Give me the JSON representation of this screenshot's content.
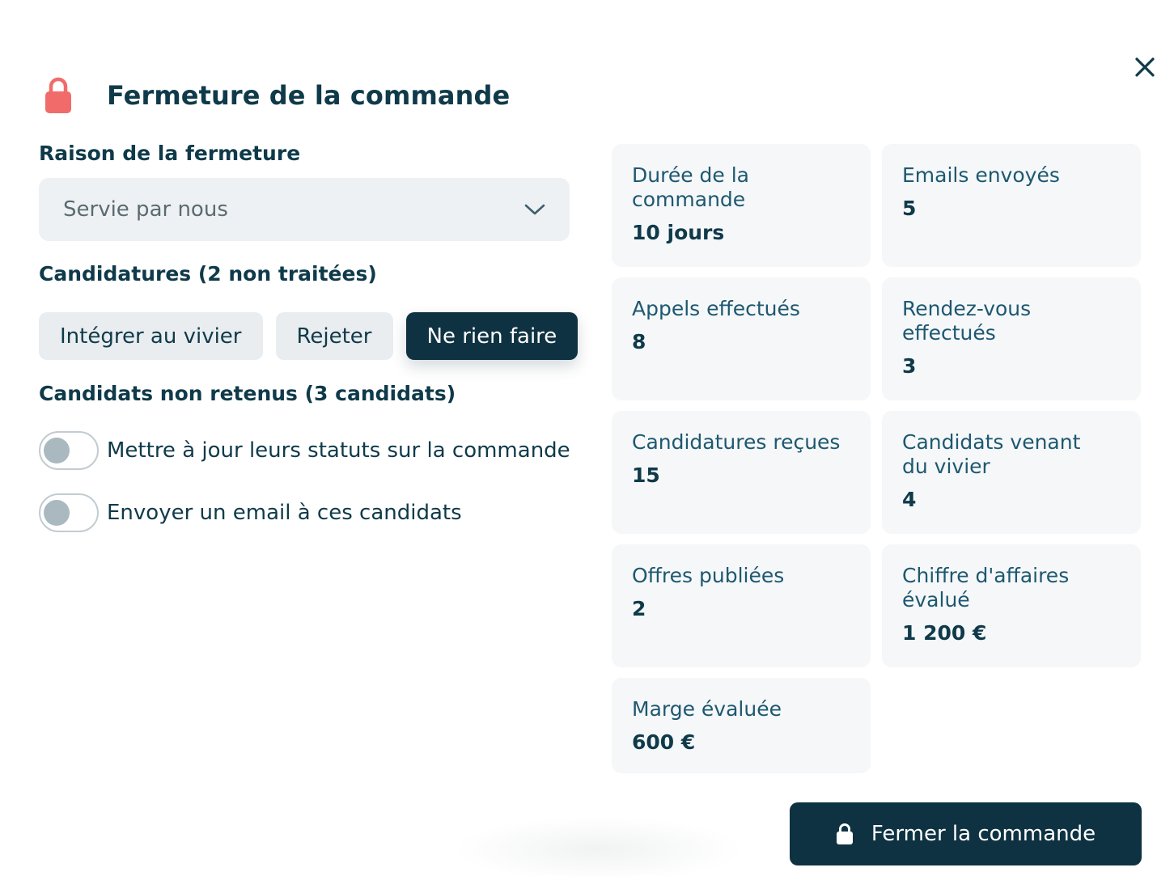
{
  "modal": {
    "title": "Fermeture de la commande",
    "close_icon": "close-icon",
    "accent_color": "#f26b6b",
    "primary_color": "#0e3242"
  },
  "reason": {
    "label": "Raison de la fermeture",
    "selected": "Servie par nous"
  },
  "applications": {
    "label": "Candidatures (2 non traitées)",
    "buttons": [
      {
        "label": "Intégrer au vivier",
        "active": false
      },
      {
        "label": "Rejeter",
        "active": false
      },
      {
        "label": "Ne rien faire",
        "active": true
      }
    ]
  },
  "rejected": {
    "label": "Candidats non retenus (3 candidats)",
    "toggles": [
      {
        "label": "Mettre à jour leurs statuts sur la commande",
        "on": false
      },
      {
        "label": "Envoyer un email à ces candidats",
        "on": false
      }
    ]
  },
  "stats": [
    {
      "label": "Durée de la commande",
      "value": "10 jours"
    },
    {
      "label": "Emails envoyés",
      "value": "5"
    },
    {
      "label": "Appels effectués",
      "value": "8"
    },
    {
      "label": "Rendez-vous effectués",
      "value": "3"
    },
    {
      "label": "Candidatures reçues",
      "value": "15"
    },
    {
      "label": "Candidats venant du vivier",
      "value": "4"
    },
    {
      "label": "Offres publiées",
      "value": "2"
    },
    {
      "label": "Chiffre d'affaires évalué",
      "value": "1 200 €"
    },
    {
      "label": "Marge évaluée",
      "value": "600 €"
    }
  ],
  "footer": {
    "submit_label": "Fermer la commande"
  }
}
